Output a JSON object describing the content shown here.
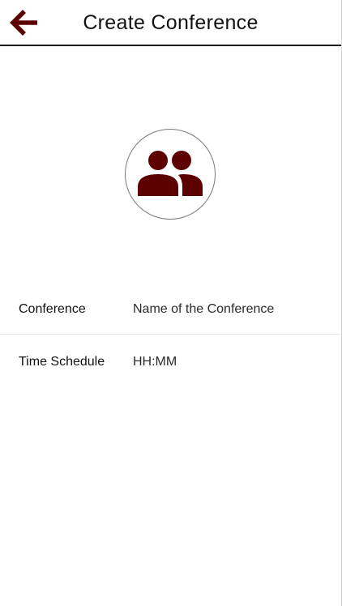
{
  "header": {
    "title": "Create Conference",
    "back_icon": "arrow-left-icon"
  },
  "avatar": {
    "icon": "group-icon"
  },
  "form": {
    "conference": {
      "label": "Conference",
      "value": "",
      "placeholder": "Name of the Conference"
    },
    "time_schedule": {
      "label": "Time Schedule",
      "value": "",
      "placeholder": "HH:MM"
    }
  },
  "colors": {
    "accent": "#5c0000",
    "divider": "#1a1a1a",
    "avatar_border": "#7a7a7a"
  }
}
